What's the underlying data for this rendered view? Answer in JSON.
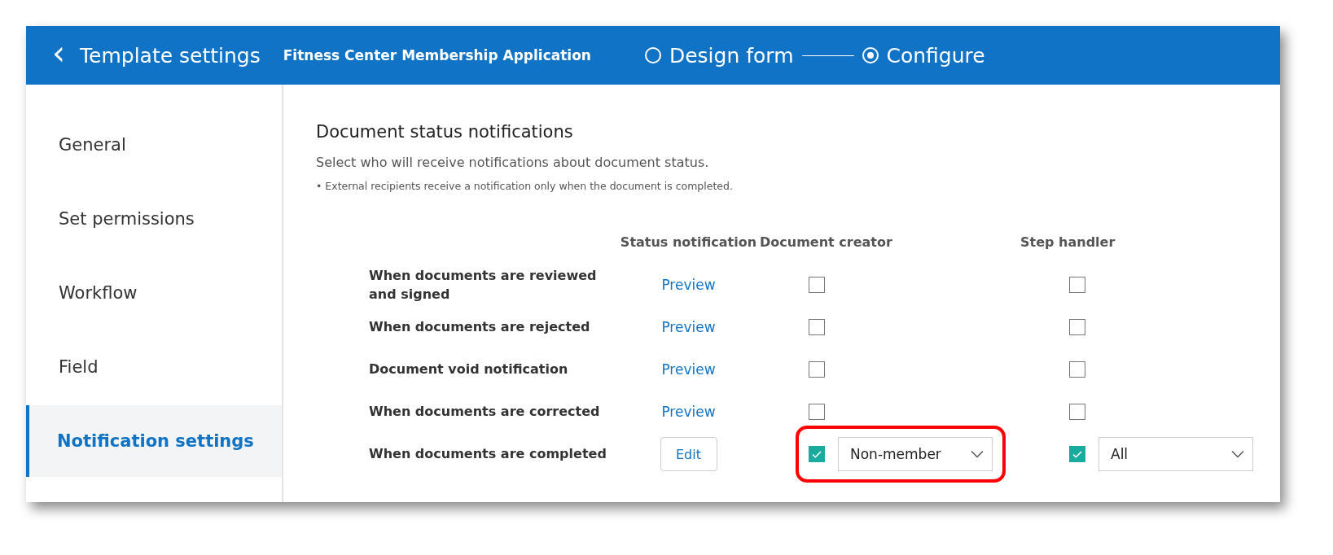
{
  "header": {
    "back_icon": "‹",
    "title": "Template settings",
    "document": "Fitness Center Membership Application",
    "steps": [
      {
        "label": "Design form",
        "selected": false
      },
      {
        "label": "Configure",
        "selected": true
      }
    ]
  },
  "sidebar": {
    "items": [
      {
        "label": "General",
        "selected": false
      },
      {
        "label": "Set permissions",
        "selected": false
      },
      {
        "label": "Workflow",
        "selected": false
      },
      {
        "label": "Field",
        "selected": false
      },
      {
        "label": "Notification settings",
        "selected": true
      }
    ]
  },
  "section": {
    "title": "Document status notifications",
    "description": "Select who will receive notifications about document status.",
    "note": "• External recipients receive a notification only when the document is completed."
  },
  "table": {
    "columns": [
      "Status notification",
      "Document creator",
      "Step handler"
    ],
    "rows": [
      {
        "label": "When documents are reviewed and signed",
        "action": {
          "kind": "link",
          "text": "Preview"
        },
        "creator": {
          "checked": false
        },
        "handler": {
          "checked": false
        }
      },
      {
        "label": "When documents are rejected",
        "action": {
          "kind": "link",
          "text": "Preview"
        },
        "creator": {
          "checked": false
        },
        "handler": {
          "checked": false
        }
      },
      {
        "label": "Document void notification",
        "action": {
          "kind": "link",
          "text": "Preview"
        },
        "creator": {
          "checked": false
        },
        "handler": {
          "checked": false
        }
      },
      {
        "label": "When documents are corrected",
        "action": {
          "kind": "link",
          "text": "Preview"
        },
        "creator": {
          "checked": false
        },
        "handler": {
          "checked": false
        }
      },
      {
        "label": "When documents are completed",
        "action": {
          "kind": "button",
          "text": "Edit"
        },
        "creator": {
          "checked": true,
          "value": "Non-member",
          "highlighted": true
        },
        "handler": {
          "checked": true,
          "value": "All"
        }
      }
    ]
  }
}
